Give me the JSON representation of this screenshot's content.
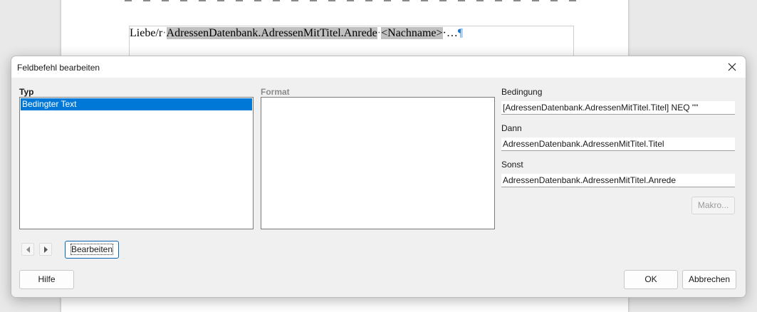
{
  "document": {
    "text_prefix": "Liebe/r",
    "sep1": "·",
    "field_anrede": "AdressenDatenbank.AdressenMitTitel.Anrede",
    "sep2": "·",
    "field_nachname": "<Nachname>",
    "suffix": "·…",
    "pilcrow": "¶"
  },
  "dialog": {
    "title": "Feldbefehl bearbeiten",
    "typ": {
      "label": "Typ",
      "items": [
        "Bedingter Text"
      ],
      "selected_index": 0
    },
    "format": {
      "label": "Format",
      "items": []
    },
    "bedingung": {
      "label": "Bedingung",
      "value": "[AdressenDatenbank.AdressenMitTitel.Titel] NEQ \"\""
    },
    "dann": {
      "label": "Dann",
      "value": "AdressenDatenbank.AdressenMitTitel.Titel"
    },
    "sonst": {
      "label": "Sonst",
      "value": "AdressenDatenbank.AdressenMitTitel.Anrede"
    },
    "buttons": {
      "makro": "Makro...",
      "bearbeiten": "Bearbeiten",
      "hilfe": "Hilfe",
      "ok": "OK",
      "abbrechen": "Abbrechen"
    }
  },
  "colors": {
    "selection": "#0078d7",
    "field_shading": "#c0c0c0",
    "pilcrow": "#1f78d1"
  }
}
